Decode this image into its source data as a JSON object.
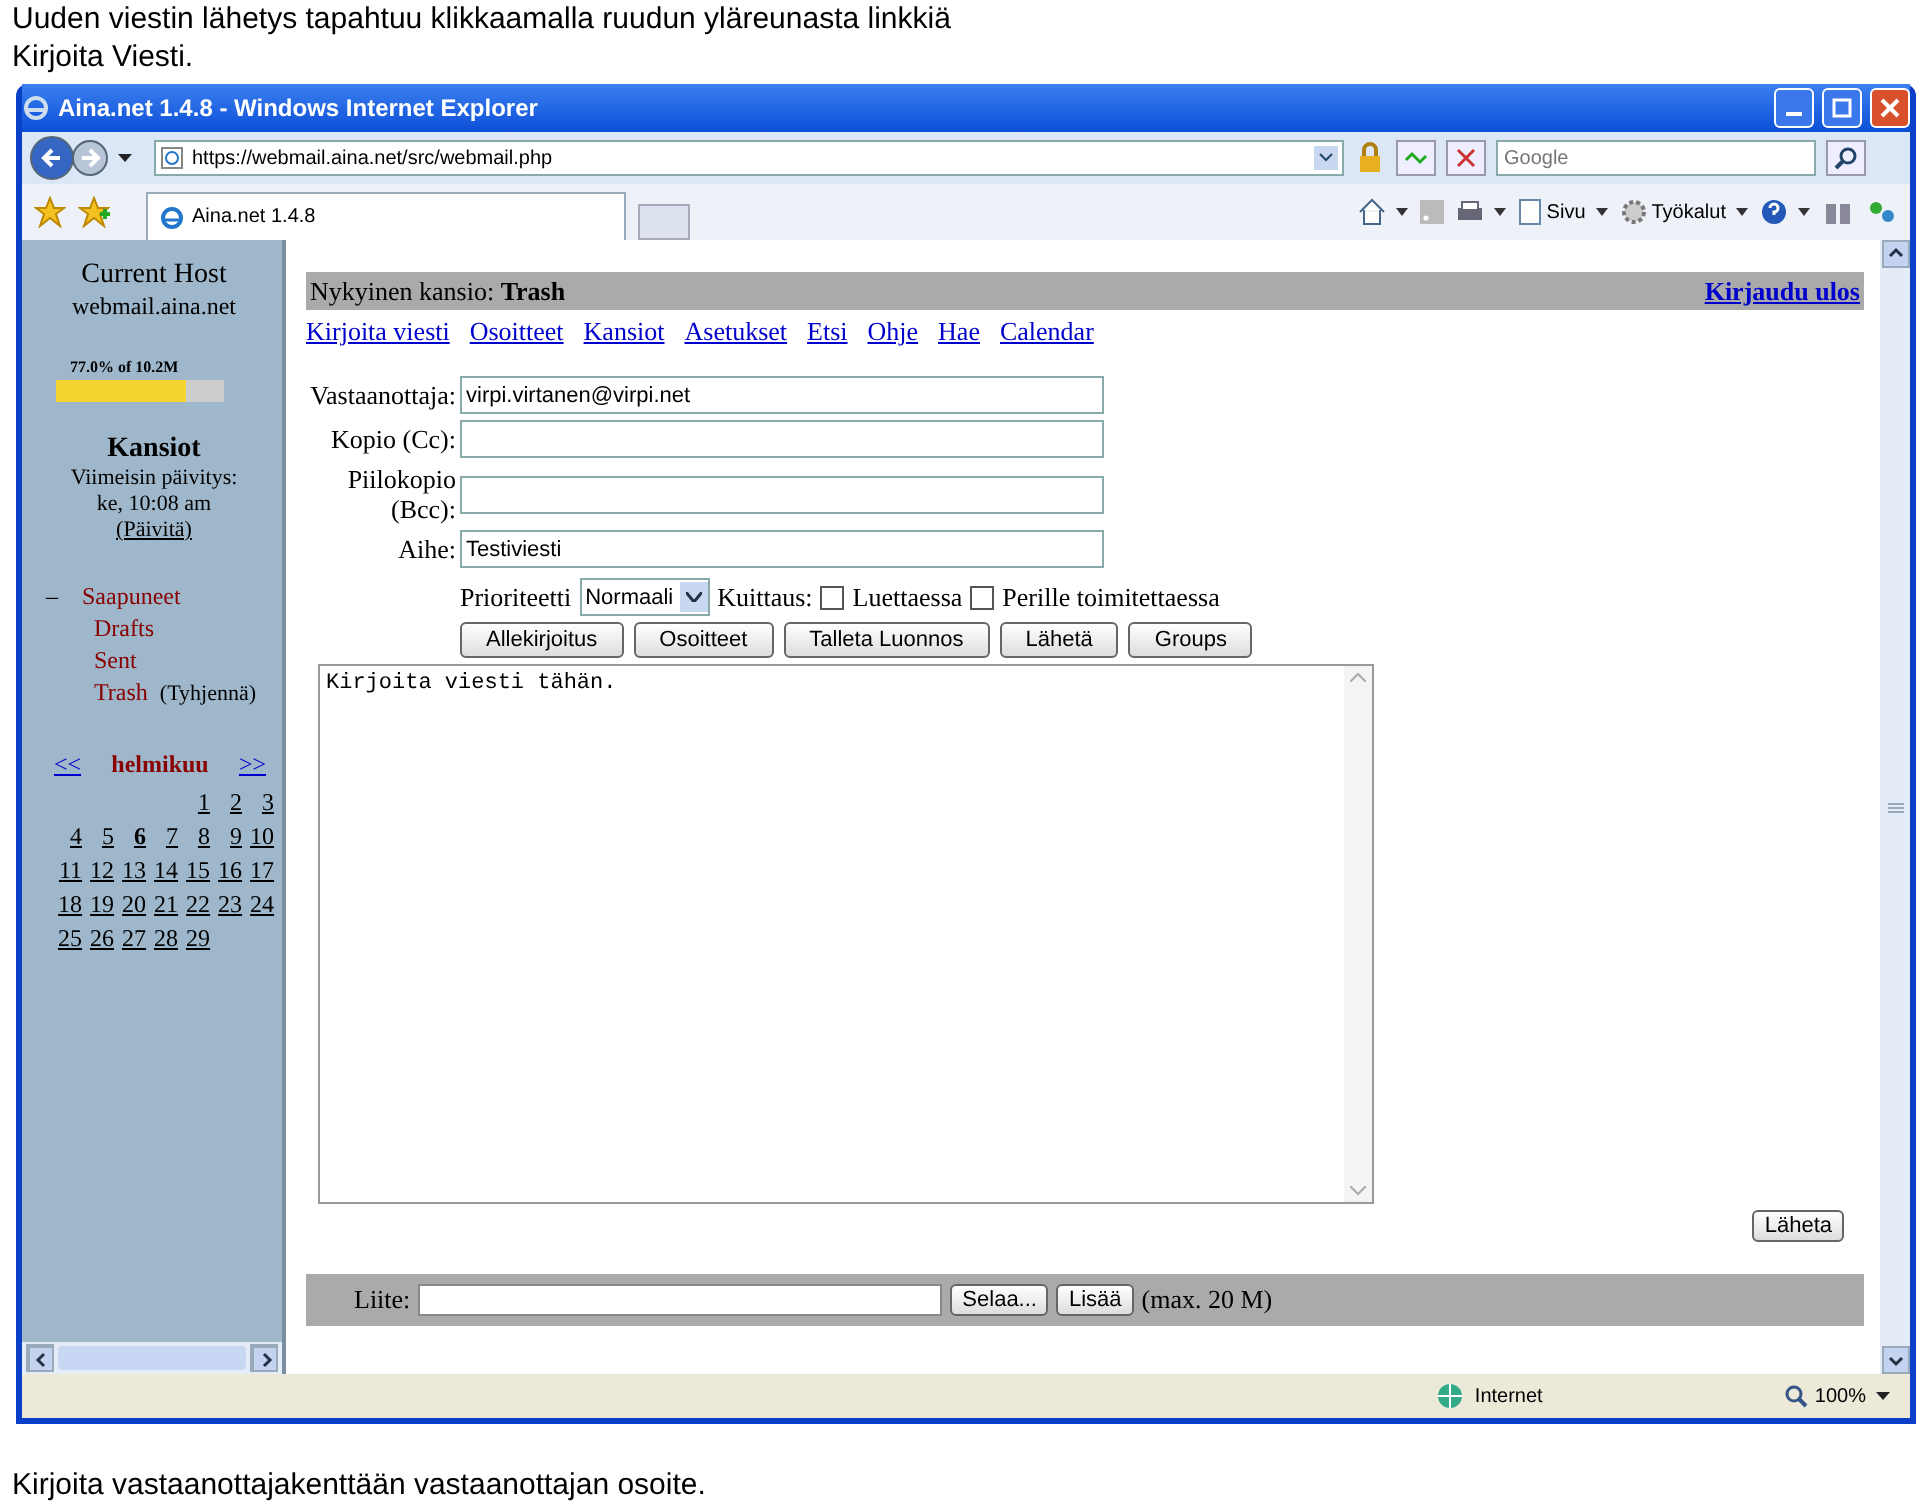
{
  "caption_top": "Uuden viestin lähetys tapahtuu klikkaamalla ruudun yläreunasta linkkiä Kirjoita Viesti.",
  "window": {
    "title": "Aina.net 1.4.8 - Windows Internet Explorer",
    "address": "https://webmail.aina.net/src/webmail.php",
    "search_placeholder": "Google",
    "tab": "Aina.net 1.4.8",
    "commands": [
      {
        "kind": "home"
      },
      {
        "kind": "feed"
      },
      {
        "kind": "print"
      },
      {
        "kind": "page",
        "label": "Sivu"
      },
      {
        "kind": "tools",
        "label": "Työkalut"
      },
      {
        "kind": "help"
      }
    ]
  },
  "sidebar": {
    "host_title": "Current Host",
    "host": "webmail.aina.net",
    "quota": {
      "label": "77.0% of 10.2M",
      "level": 0.77
    },
    "folders_title": "Kansiot",
    "updated_label": "Viimeisin päivitys:",
    "updated": "ke, 10:08 am",
    "refresh": "(Päivitä)",
    "folders": [
      {
        "label": "Saapuneet",
        "toggle": "–",
        "expanded": true,
        "children": [
          {
            "label": "Drafts"
          },
          {
            "label": "Sent"
          },
          {
            "label": "Trash",
            "action": "(Tyhjennä)"
          }
        ]
      }
    ],
    "calendar": {
      "prev": "<<",
      "month": "helmikuu",
      "next": ">>",
      "weeks": [
        [
          {
            "day": "1",
            "selected": false
          },
          {
            "day": "2",
            "selected": false
          },
          {
            "day": "3",
            "selected": false
          }
        ],
        [
          {
            "day": "4",
            "selected": false
          },
          {
            "day": "5",
            "selected": false
          },
          {
            "day": "6",
            "selected": true
          },
          {
            "day": "7",
            "selected": false
          },
          {
            "day": "8",
            "selected": false
          },
          {
            "day": "9",
            "selected": false
          },
          {
            "day": "10",
            "selected": false
          }
        ],
        [
          {
            "day": "11",
            "selected": false
          },
          {
            "day": "12",
            "selected": false
          },
          {
            "day": "13",
            "selected": false
          },
          {
            "day": "14",
            "selected": false
          },
          {
            "day": "15",
            "selected": false
          },
          {
            "day": "16",
            "selected": false
          },
          {
            "day": "17",
            "selected": false
          }
        ],
        [
          {
            "day": "18",
            "selected": false
          },
          {
            "day": "19",
            "selected": false
          },
          {
            "day": "20",
            "selected": false
          },
          {
            "day": "21",
            "selected": false
          },
          {
            "day": "22",
            "selected": false
          },
          {
            "day": "23",
            "selected": false
          },
          {
            "day": "24",
            "selected": false
          }
        ],
        [
          {
            "day": "25",
            "selected": false
          },
          {
            "day": "26",
            "selected": false
          },
          {
            "day": "27",
            "selected": false
          },
          {
            "day": "28",
            "selected": false
          },
          {
            "day": "29",
            "selected": false
          }
        ]
      ]
    }
  },
  "main": {
    "folder_label": "Nykyinen kansio:",
    "folder": "Trash",
    "logout": "Kirjaudu ulos",
    "nav": [
      "Kirjoita viesti",
      "Osoitteet",
      "Kansiot",
      "Asetukset",
      "Etsi",
      "Ohje",
      "Hae",
      "Calendar"
    ],
    "fields": [
      {
        "label": "Vastaanottaja:",
        "value": "virpi.virtanen@virpi.net"
      },
      {
        "label": "Kopio (Cc):"
      },
      {
        "label": "Piilokopio (Bcc):"
      },
      {
        "label": "Aihe:",
        "value": "Testiviesti"
      }
    ],
    "priority_label": "Prioriteetti",
    "priority": "Normaali",
    "receipt_label": "Kuittaus:",
    "receipts": [
      {
        "label": "Luettaessa",
        "checked": false
      },
      {
        "label": "Perille toimitettaessa",
        "checked": false
      }
    ],
    "buttons": [
      "Allekirjoitus",
      "Osoitteet",
      "Talleta Luonnos",
      "Lähetä",
      "Groups"
    ],
    "body": "Kirjoita viesti tähän.",
    "send": "Läheta",
    "attach_label": "Liite:",
    "browse": "Selaa...",
    "add": "Lisää",
    "max": "(max. 20 M)"
  },
  "status": {
    "zone": "Internet",
    "zoom": "100%"
  },
  "caption_bottom": "Kirjoita vastaanottajakenttään vastaanottajan osoite."
}
